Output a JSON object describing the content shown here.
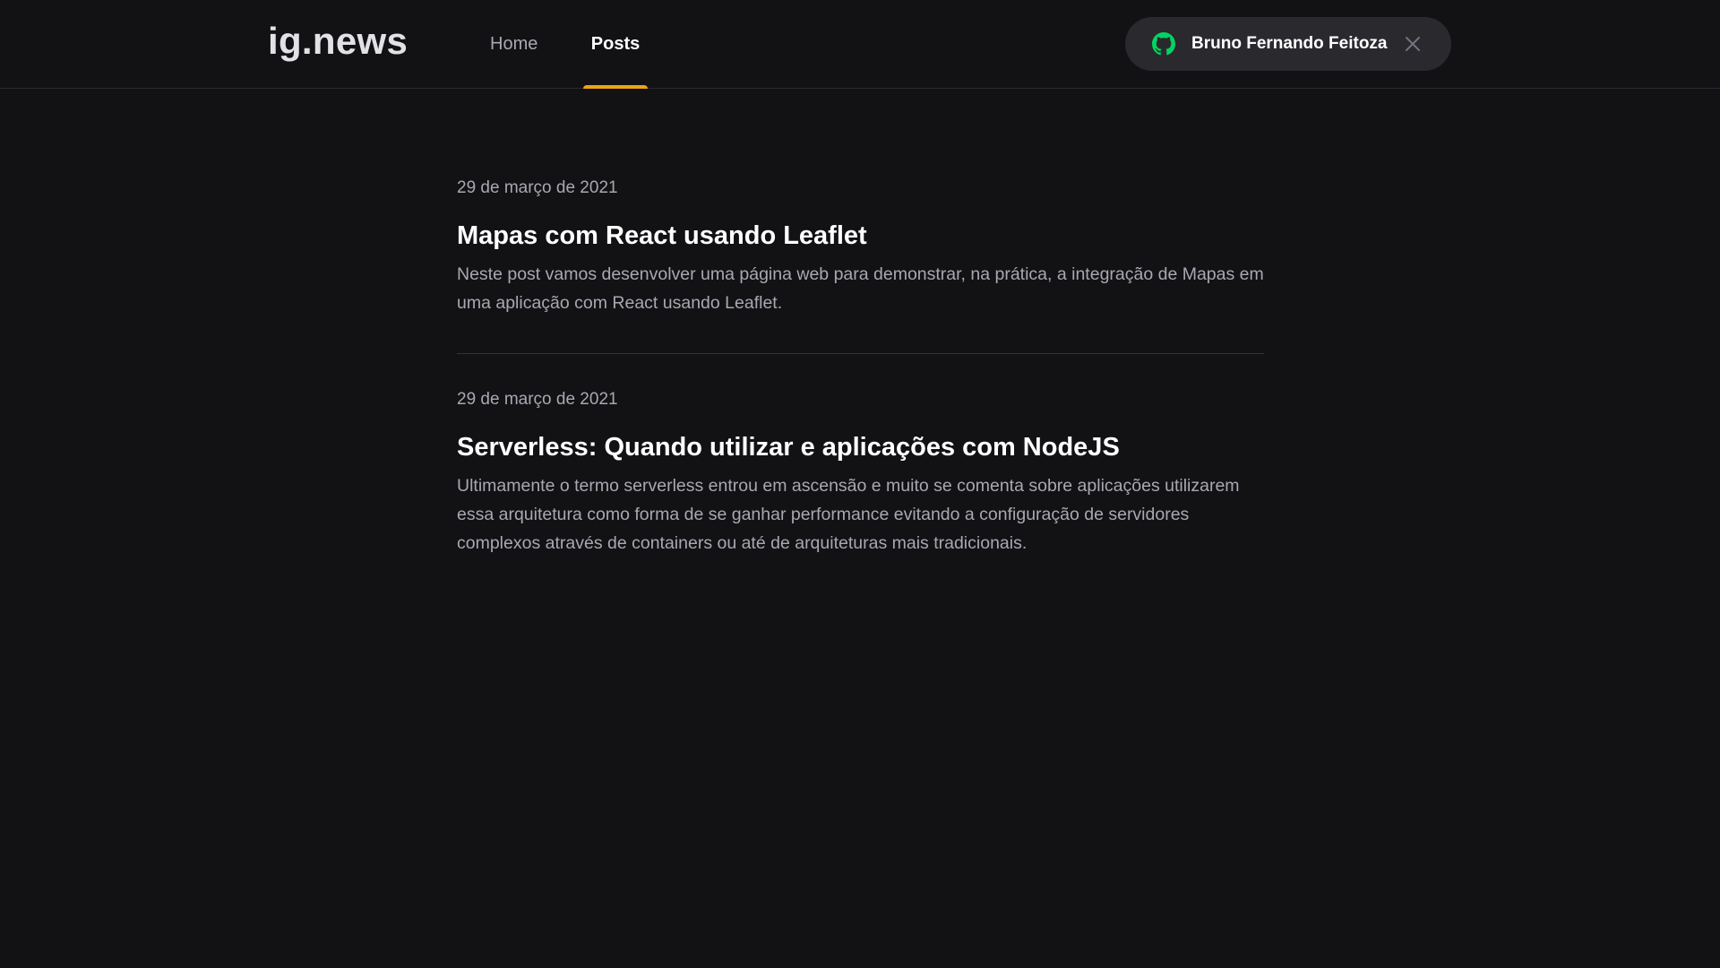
{
  "header": {
    "logo": "ig.news",
    "nav": {
      "home": "Home",
      "posts": "Posts",
      "active": "posts"
    },
    "user": {
      "name": "Bruno Fernando Feitoza",
      "icon": "github-icon",
      "icon_color": "#04d361",
      "close_icon": "close-icon"
    },
    "accent_color": "#eba417"
  },
  "posts": [
    {
      "date": "29 de março de 2021",
      "title": "Mapas com React usando Leaflet",
      "excerpt": "Neste post vamos desenvolver uma página web para demonstrar, na prática, a integração de Mapas em uma aplicação com React usando Leaflet."
    },
    {
      "date": "29 de março de 2021",
      "title": "Serverless: Quando utilizar e aplicações com NodeJS",
      "excerpt": "Ultimamente o termo serverless entrou em ascensão e muito se comenta sobre aplicações utilizarem essa arquitetura como forma de se ganhar performance evitando a configuração de servidores complexos através de containers ou até de arquiteturas mais tradicionais."
    }
  ]
}
